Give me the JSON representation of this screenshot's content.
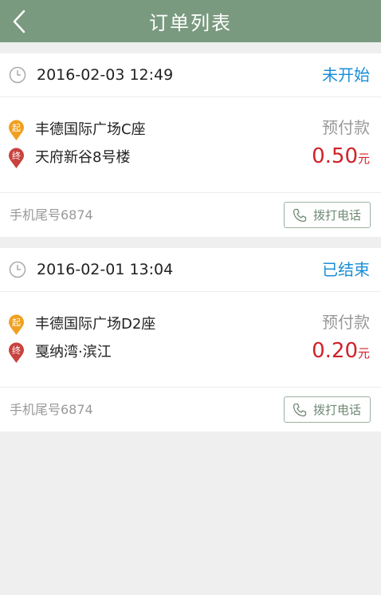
{
  "header": {
    "title": "订单列表"
  },
  "orders": [
    {
      "time": "2016-02-03 12:49",
      "status": "未开始",
      "start_badge": "起",
      "end_badge": "终",
      "start_address": "丰德国际广场C座",
      "end_address": "天府新谷8号楼",
      "prepay_label": "预付款",
      "price": "0.50",
      "price_unit": "元",
      "phone_tail": "手机尾号6874",
      "call_label": "拨打电话"
    },
    {
      "time": "2016-02-01 13:04",
      "status": "已结束",
      "start_badge": "起",
      "end_badge": "终",
      "start_address": "丰德国际广场D2座",
      "end_address": "戛纳湾·滨江",
      "prepay_label": "预付款",
      "price": "0.20",
      "price_unit": "元",
      "phone_tail": "手机尾号6874",
      "call_label": "拨打电话"
    }
  ],
  "colors": {
    "header": "#7a9a80",
    "status": "#1a8fd6",
    "price": "#d0222a",
    "start_pin": "#f0a020",
    "end_pin": "#c8433f"
  }
}
